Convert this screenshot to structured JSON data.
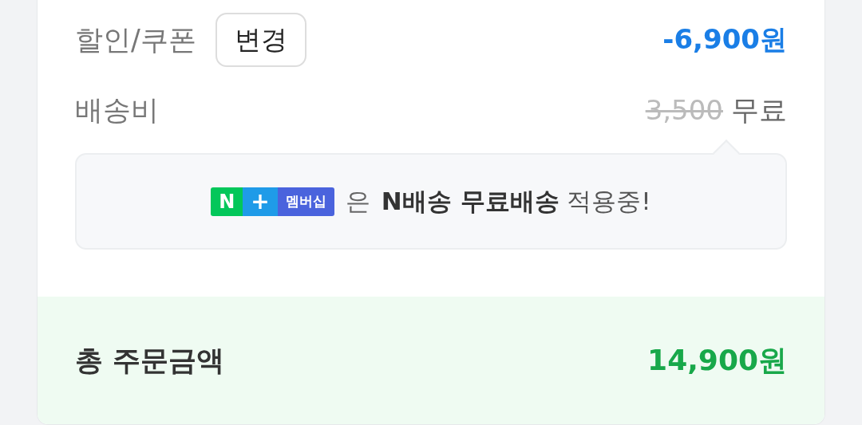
{
  "discount": {
    "label": "할인/쿠폰",
    "button": "변경",
    "amount": "-6,900원"
  },
  "shipping": {
    "label": "배송비",
    "original_price": "3,500",
    "price": "무료"
  },
  "notice": {
    "badge": {
      "n": "N",
      "plus": "+",
      "text": "멤버십"
    },
    "particle": "은",
    "message": "**N배송 무료배송** 적용중!"
  },
  "total": {
    "label": "총 주문금액",
    "amount": "14,900원"
  }
}
